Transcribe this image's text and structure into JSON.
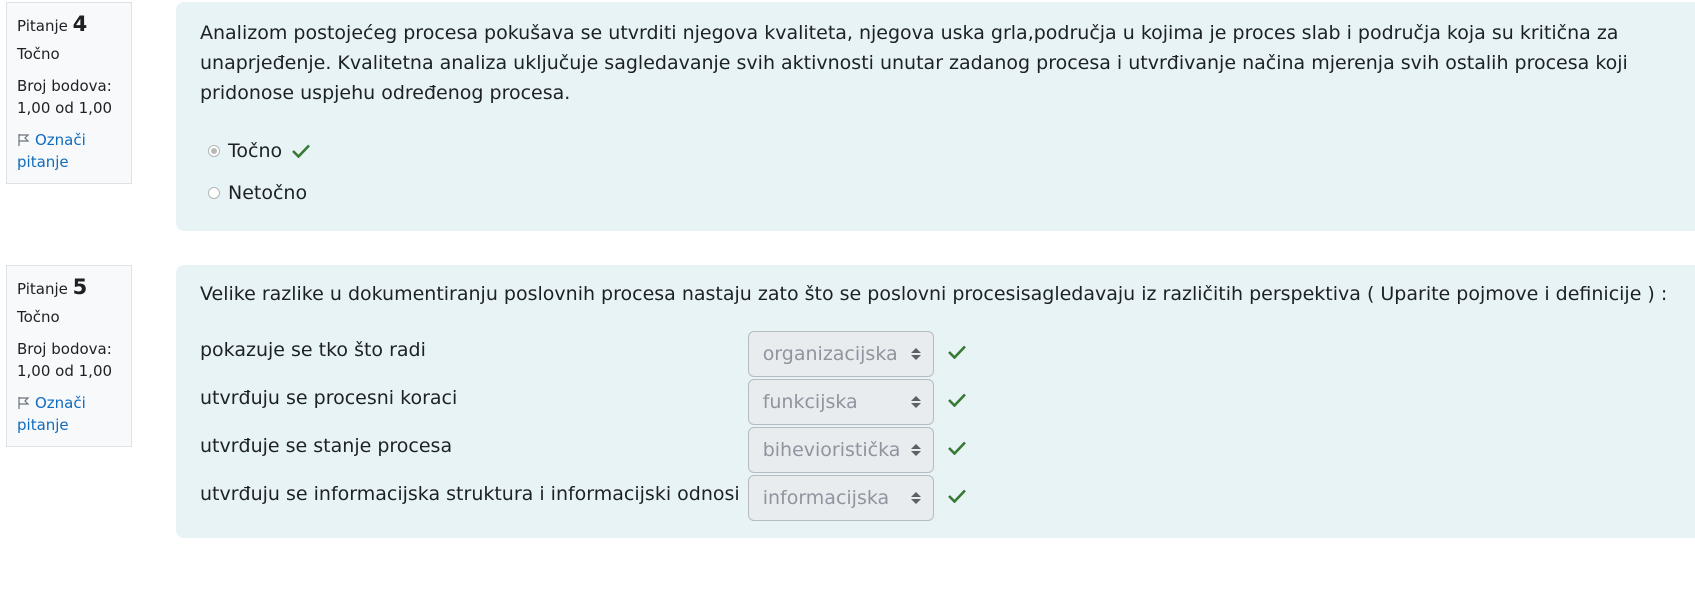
{
  "questions": [
    {
      "label": "Pitanje",
      "number": "4",
      "state": "Točno",
      "grade_label": "Broj bodova:",
      "grade_value": "1,00 od 1,00",
      "flag_line1": "Označi",
      "flag_line2": "pitanje",
      "text": "Analizom postojećeg procesa pokušava se utvrditi njegova kvaliteta, njegova uska grla,područja u kojima je proces slab i područja koja su kritična za unaprjeđenje. Kvalitetna analiza uključuje sagledavanje svih aktivnosti unutar zadanog procesa i utvrđivanje načina mjerenja svih ostalih procesa koji pridonose uspjehu određenog procesa.",
      "options": [
        {
          "label": "Točno",
          "selected": true,
          "correct": true
        },
        {
          "label": "Netočno",
          "selected": false,
          "correct": false
        }
      ]
    },
    {
      "label": "Pitanje",
      "number": "5",
      "state": "Točno",
      "grade_label": "Broj bodova:",
      "grade_value": "1,00 od 1,00",
      "flag_line1": "Označi",
      "flag_line2": "pitanje",
      "text": "Velike razlike u dokumentiranju poslovnih procesa nastaju zato što se poslovni procesisagledavaju iz različitih perspektiva ( Uparite pojmove i definicije ) :",
      "matches": [
        {
          "stem": "pokazuje se tko što radi",
          "selected": "organizacijska"
        },
        {
          "stem": "utvrđuju se procesni koraci",
          "selected": "funkcijska"
        },
        {
          "stem": "utvrđuje se stanje procesa",
          "selected": "bihevioristička"
        },
        {
          "stem": "utvrđuju se informacijska struktura i informacijski odnosi",
          "selected": "informacijska"
        }
      ]
    }
  ],
  "colors": {
    "accent_link": "#0f6cbf",
    "correct_check": "#357a32",
    "content_bg": "#e7f3f5"
  }
}
